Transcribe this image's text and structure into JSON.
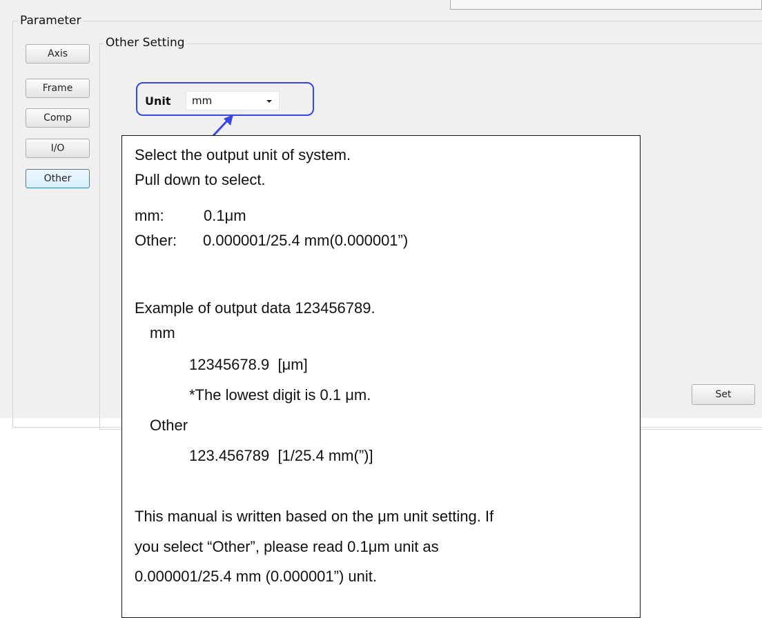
{
  "window": {
    "section_title": "Parameter",
    "group_title": "Other Setting"
  },
  "sidebar": {
    "items": [
      {
        "label": "Axis"
      },
      {
        "label": "Frame"
      },
      {
        "label": "Comp"
      },
      {
        "label": "I/O"
      },
      {
        "label": "Other",
        "active": true
      }
    ]
  },
  "unit_field": {
    "label": "Unit",
    "selected": "mm"
  },
  "actions": {
    "set_label": "Set"
  },
  "colors": {
    "highlight": "#3545e8",
    "active_button_border": "#3c7fb1"
  },
  "note": {
    "lines": [
      "Select the output unit of system.",
      "Pull down to select.",
      "mm:",
      "0.1μm",
      "Other:",
      "0.000001/25.4 mm(0.000001”)",
      "Example of output data 123456789.",
      "mm",
      "12345678.9  [μm]",
      "*The lowest digit is 0.1 μm.",
      "Other",
      "123.456789  [1/25.4 mm(”)]",
      "This manual is written based on the μm unit setting. If",
      "you select “Other”, please read 0.1μm unit as",
      "0.000001/25.4 mm (0.000001”) unit."
    ]
  }
}
